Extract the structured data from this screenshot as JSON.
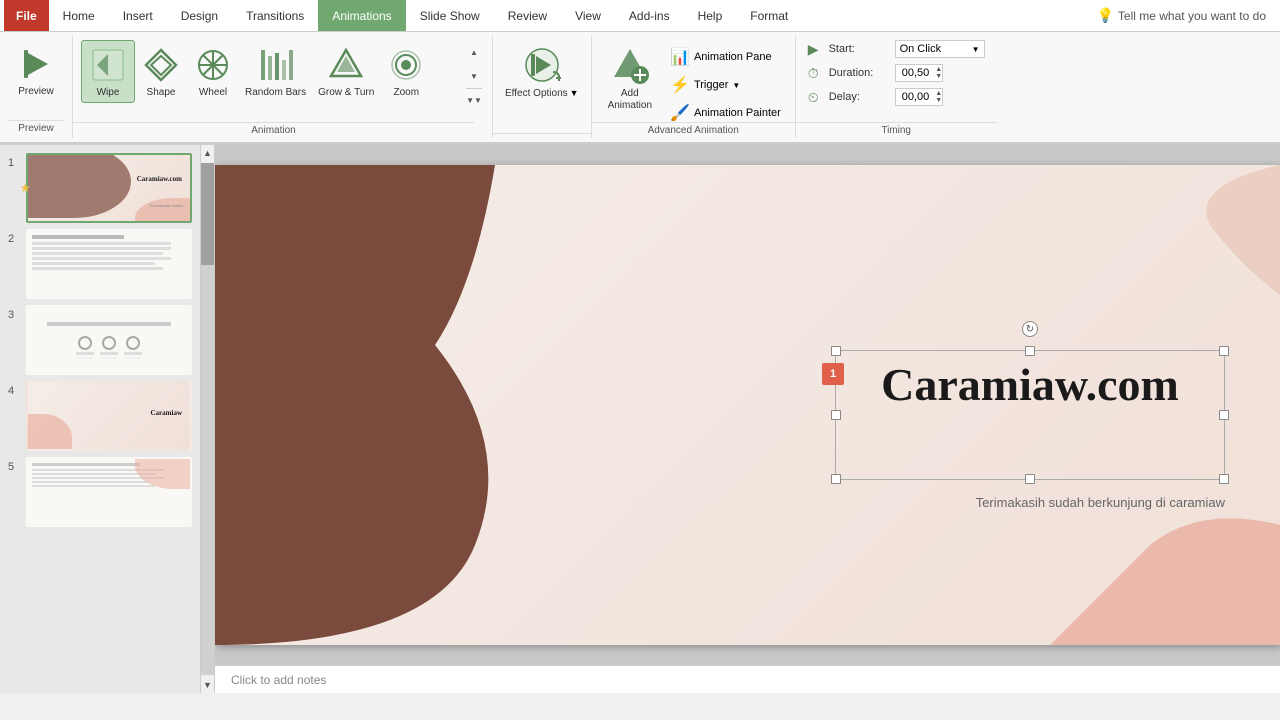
{
  "tabs": {
    "file": "File",
    "home": "Home",
    "insert": "Insert",
    "design": "Design",
    "transitions": "Transitions",
    "animations": "Animations",
    "slideshow": "Slide Show",
    "review": "Review",
    "view": "View",
    "addins": "Add-ins",
    "help": "Help",
    "format": "Format",
    "tell_me": "Tell me what you want to do"
  },
  "ribbon": {
    "preview_label": "Preview",
    "animation_label": "Animation",
    "advanced_label": "Advanced Animation",
    "timing_label": "Timing",
    "animations": [
      {
        "id": "wipe",
        "label": "Wipe",
        "selected": true
      },
      {
        "id": "shape",
        "label": "Shape"
      },
      {
        "id": "wheel",
        "label": "Wheel"
      },
      {
        "id": "random_bars",
        "label": "Random Bars"
      },
      {
        "id": "grow_turn",
        "label": "Grow & Turn"
      },
      {
        "id": "zoom",
        "label": "Zoom"
      }
    ],
    "effect_options": "Effect Options",
    "add_animation": "Add\nAnimation",
    "animation_pane": "Animation Pane",
    "trigger": "Trigger",
    "animation_painter": "Animation Painter",
    "start_label": "Start:",
    "start_value": "On Click",
    "duration_label": "Duration:",
    "duration_value": "00,50",
    "delay_label": "Delay:",
    "delay_value": "00,00"
  },
  "slides": [
    {
      "number": "1",
      "active": true,
      "has_star": true
    },
    {
      "number": "2",
      "active": false,
      "has_star": false
    },
    {
      "number": "3",
      "active": false,
      "has_star": false
    },
    {
      "number": "4",
      "active": false,
      "has_star": false
    },
    {
      "number": "5",
      "active": false,
      "has_star": false
    }
  ],
  "slide_content": {
    "title": "Caramiaw.com",
    "subtitle": "Terimakasih sudah berkunjung di caramiaw",
    "animation_badge": "1"
  },
  "notes": {
    "placeholder": "Click to add notes"
  }
}
